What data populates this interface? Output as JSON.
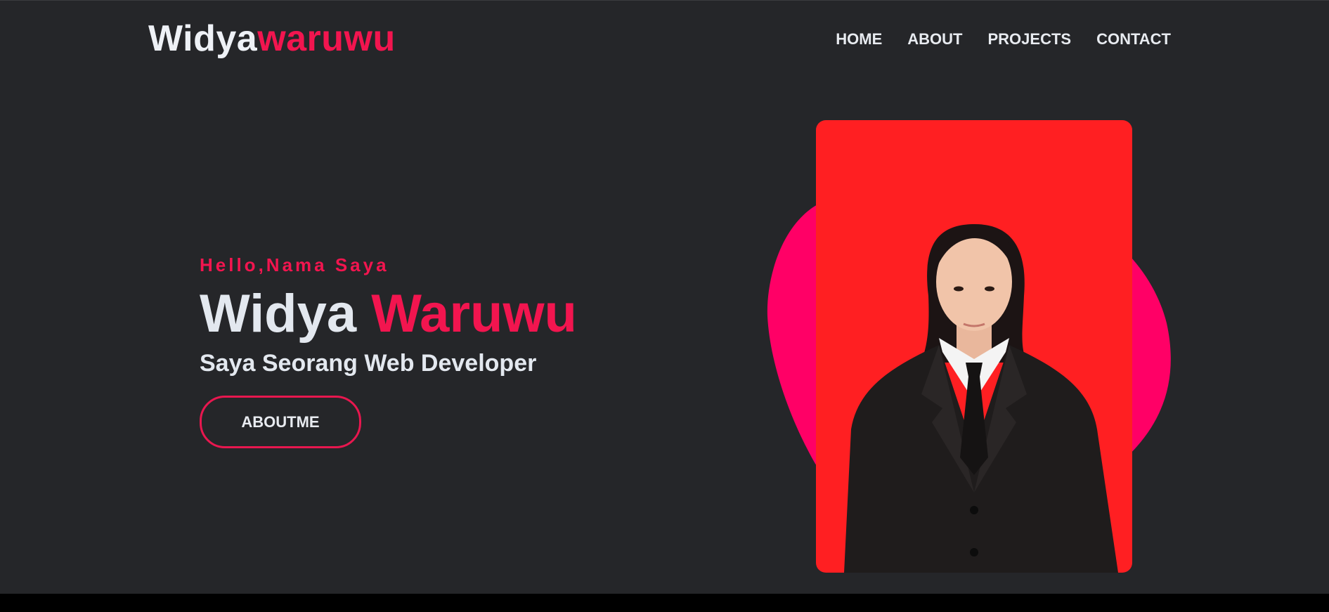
{
  "logo": {
    "first": "Widya",
    "second": "waruwu"
  },
  "nav": {
    "items": [
      {
        "label": "HOME"
      },
      {
        "label": "ABOUT"
      },
      {
        "label": "PROJECTS"
      },
      {
        "label": "CONTACT"
      }
    ]
  },
  "hero": {
    "greeting": "Hello,Nama Saya",
    "name_first": "Widya",
    "name_last": "Waruwu",
    "role": "Saya Seorang Web Developer",
    "button_label": "ABOUTME"
  },
  "colors": {
    "background": "#252629",
    "accent": "#f2154f",
    "blob": "#ff0066",
    "photo_background": "#ff1f22",
    "text": "#e3e8ef"
  }
}
